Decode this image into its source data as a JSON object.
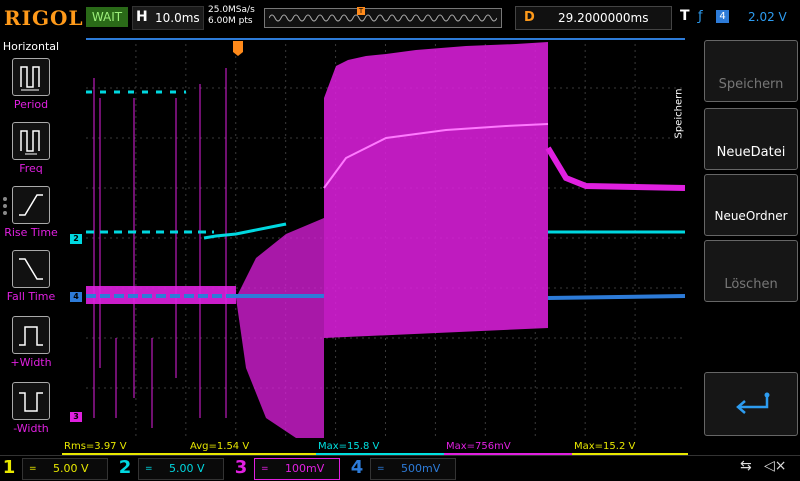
{
  "top": {
    "brand": "RIGOL",
    "status": "WAIT",
    "hlabel": "H",
    "timebase": "10.0ms",
    "sample_rate": "25.0MSa/s",
    "memory_depth": "6.00M pts",
    "trigger_marker": "T",
    "delay_label": "D",
    "delay_value": "29.2000000ms",
    "trigger_label": "T",
    "trigger_edge_icon": "rising-edge-icon",
    "trigger_source": "4",
    "trigger_level": "2.02 V"
  },
  "left_menu": {
    "title": "Horizontal",
    "items": [
      {
        "label": "Period",
        "icon": "period-icon"
      },
      {
        "label": "Freq",
        "icon": "freq-icon"
      },
      {
        "label": "Rise Time",
        "icon": "rise-time-icon"
      },
      {
        "label": "Fall Time",
        "icon": "fall-time-icon"
      },
      {
        "label": "+Width",
        "icon": "positive-width-icon"
      },
      {
        "label": "-Width",
        "icon": "negative-width-icon"
      }
    ]
  },
  "right_menu": {
    "title": "Speichern",
    "buttons": [
      {
        "label": "Speichern",
        "enabled": false
      },
      {
        "label": "NeueDatei",
        "enabled": true
      },
      {
        "label": "NeueOrdner",
        "enabled": true
      },
      {
        "label": "Löschen",
        "enabled": false
      }
    ],
    "return_icon": "return-arrow-icon"
  },
  "channel_markers": {
    "ch2": "2",
    "ch4": "4",
    "ch3": "3"
  },
  "measurements": [
    {
      "text": "Rms=3.97 V",
      "color": "#e8e800"
    },
    {
      "text": "Avg=1.54 V",
      "color": "#e8e800"
    },
    {
      "text": "Max=15.8 V",
      "color": "#00e0e0"
    },
    {
      "text": "Max=756mV",
      "color": "#e020e0"
    },
    {
      "text": "Max=15.2 V",
      "color": "#e8e800"
    }
  ],
  "channels": [
    {
      "num": "1",
      "coupling": "=",
      "scale": "5.00 V",
      "color": "#e8e800"
    },
    {
      "num": "2",
      "coupling": "=",
      "scale": "5.00 V",
      "color": "#00d8e0"
    },
    {
      "num": "3",
      "coupling": "=",
      "scale": "100mV",
      "color": "#e020e0"
    },
    {
      "num": "4",
      "coupling": "=",
      "scale": "500mV",
      "color": "#2d7bd8"
    }
  ],
  "status_icons": {
    "usb": "usb-icon",
    "mute": "mute-icon"
  },
  "colors": {
    "brand": "#ff9a1a",
    "ch1": "#e8e800",
    "ch2": "#00d8e0",
    "ch3": "#e020e0",
    "ch4": "#2d7bd8"
  }
}
